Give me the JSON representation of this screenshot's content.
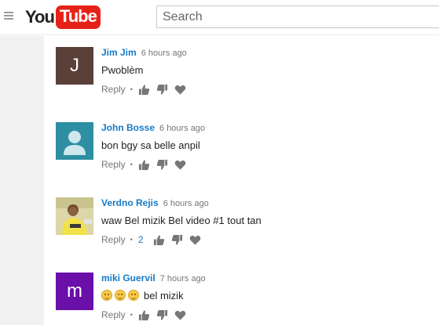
{
  "header": {
    "logo_you": "You",
    "logo_tube": "Tube",
    "search_placeholder": "Search"
  },
  "comments": [
    {
      "avatar": {
        "type": "letter",
        "letter": "J",
        "color": "#5a4038"
      },
      "author": "Jim Jim",
      "time": "6 hours ago",
      "text": "Pwoblèm",
      "reply_label": "Reply",
      "separator": "•",
      "like_count": ""
    },
    {
      "avatar": {
        "type": "default-user",
        "color": "#2e8fa3"
      },
      "author": "John Bosse",
      "time": "6 hours ago",
      "text": "bon bgy sa belle anpil",
      "reply_label": "Reply",
      "separator": "•",
      "like_count": ""
    },
    {
      "avatar": {
        "type": "photo"
      },
      "author": "Verdno Rejis",
      "time": "6 hours ago",
      "text": "waw Bel mizik Bel video #1 tout tan",
      "reply_label": "Reply",
      "separator": "•",
      "like_count": "2"
    },
    {
      "avatar": {
        "type": "letter",
        "letter": "m",
        "color": "#6a0fa8"
      },
      "author": "miki Guervil",
      "time": "7 hours ago",
      "text": "bel mizik",
      "emoji_count": 3,
      "reply_label": "Reply",
      "separator": "•",
      "like_count": ""
    }
  ],
  "colors": {
    "author_link": "#167ac6",
    "youtube_red": "#e62117",
    "meta_gray": "#767676",
    "icon_gray": "#767676"
  },
  "icons": [
    "menu-icon",
    "thumbs-up-icon",
    "thumbs-down-icon",
    "heart-icon",
    "smiley-emoji-icon",
    "default-user-icon"
  ]
}
